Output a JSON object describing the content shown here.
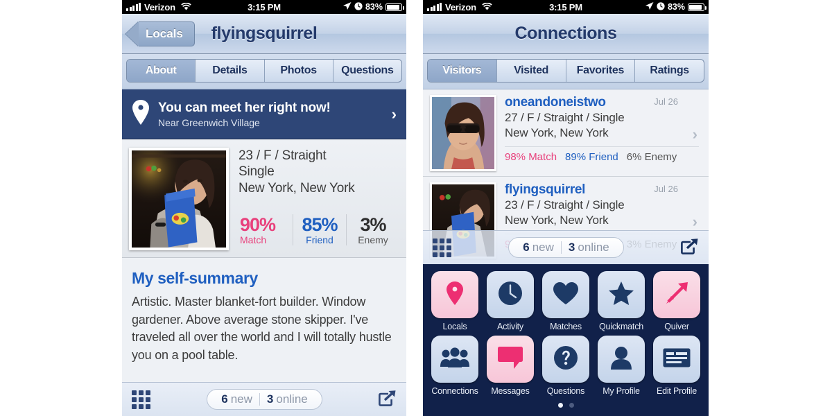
{
  "colors": {
    "navy": "#2e4677",
    "deep_navy": "#11214a",
    "link_blue": "#1f5fc0",
    "match_pink": "#e8417c",
    "tile_pink": "#f7c6d8"
  },
  "status_bar": {
    "carrier": "Verizon",
    "time": "3:15 PM",
    "battery": "83%",
    "wifi_icon": "wifi-icon",
    "location_icon": "location-arrow-icon",
    "alarm_icon": "alarm-clock-icon",
    "battery_icon": "battery-icon",
    "signal_icon": "signal-bars-icon"
  },
  "left_phone": {
    "nav": {
      "back_label": "Locals",
      "title": "flyingsquirrel",
      "back_icon": "back-chevron-icon"
    },
    "tabs": [
      {
        "label": "About",
        "active": true
      },
      {
        "label": "Details",
        "active": false
      },
      {
        "label": "Photos",
        "active": false
      },
      {
        "label": "Questions",
        "active": false
      }
    ],
    "meet_banner": {
      "icon": "map-pin-icon",
      "title": "You can meet her right now!",
      "subtitle": "Near Greenwich Village",
      "chevron": "›"
    },
    "profile": {
      "photo_alt": "woman drinking from blue cup",
      "line1": "23 / F / Straight",
      "line2": "Single",
      "line3": "New York, New York",
      "stats": [
        {
          "value": "90%",
          "label": "Match",
          "kind": "match"
        },
        {
          "value": "85%",
          "label": "Friend",
          "kind": "friend"
        },
        {
          "value": "3%",
          "label": "Enemy",
          "kind": "enemy"
        }
      ]
    },
    "summary": {
      "heading": "My self-summary",
      "body": "Artistic. Master blanket-fort builder. Window gardener. Above average stone skipper. I've traveled all over the world and I will totally hustle you on a pool table."
    },
    "toolbar": {
      "grid_icon": "grid-icon",
      "new_count": "6",
      "new_label": "new",
      "online_count": "3",
      "online_label": "online",
      "share_icon": "share-icon"
    }
  },
  "right_phone": {
    "nav": {
      "title": "Connections"
    },
    "tabs": [
      {
        "label": "Visitors",
        "active": true
      },
      {
        "label": "Visited",
        "active": false
      },
      {
        "label": "Favorites",
        "active": false
      },
      {
        "label": "Ratings",
        "active": false
      }
    ],
    "rows": [
      {
        "photo_alt": "woman wearing sunglasses",
        "name": "oneandoneistwo",
        "line1": "27 / F / Straight / Single",
        "line2": "New York, New York",
        "date": "Jul 26",
        "chevron": "›",
        "stats": [
          {
            "text": "98% Match",
            "kind": "match"
          },
          {
            "text": "89% Friend",
            "kind": "friend"
          },
          {
            "text": "6% Enemy",
            "kind": "enemy"
          }
        ]
      },
      {
        "photo_alt": "woman drinking from blue cup",
        "name": "flyingsquirrel",
        "line1": "23 / F / Straight / Single",
        "line2": "New York, New York",
        "date": "Jul 26",
        "chevron": "›",
        "stats": [
          {
            "text": "90% Match",
            "kind": "match"
          },
          {
            "text": "85% Friend",
            "kind": "friend"
          },
          {
            "text": "3% Enemy",
            "kind": "enemy"
          }
        ]
      }
    ],
    "toolbar": {
      "grid_icon": "grid-icon",
      "new_count": "6",
      "new_label": "new",
      "online_count": "3",
      "online_label": "online",
      "share_icon": "share-icon"
    },
    "apps": [
      {
        "label": "Locals",
        "icon": "map-pin-icon",
        "tile": "pink"
      },
      {
        "label": "Activity",
        "icon": "clock-icon",
        "tile": "blue"
      },
      {
        "label": "Matches",
        "icon": "heart-icon",
        "tile": "blue"
      },
      {
        "label": "Quickmatch",
        "icon": "star-icon",
        "tile": "blue"
      },
      {
        "label": "Quiver",
        "icon": "arrow-up-right-icon",
        "tile": "pink"
      },
      {
        "label": "Connections",
        "icon": "people-group-icon",
        "tile": "blue"
      },
      {
        "label": "Messages",
        "icon": "chat-bubble-icon",
        "tile": "pink"
      },
      {
        "label": "Questions",
        "icon": "question-mark-icon",
        "tile": "blue"
      },
      {
        "label": "My Profile",
        "icon": "person-icon",
        "tile": "blue"
      },
      {
        "label": "Edit Profile",
        "icon": "edit-card-icon",
        "tile": "blue"
      }
    ],
    "page_dots": {
      "count": 2,
      "active_index": 0
    }
  }
}
